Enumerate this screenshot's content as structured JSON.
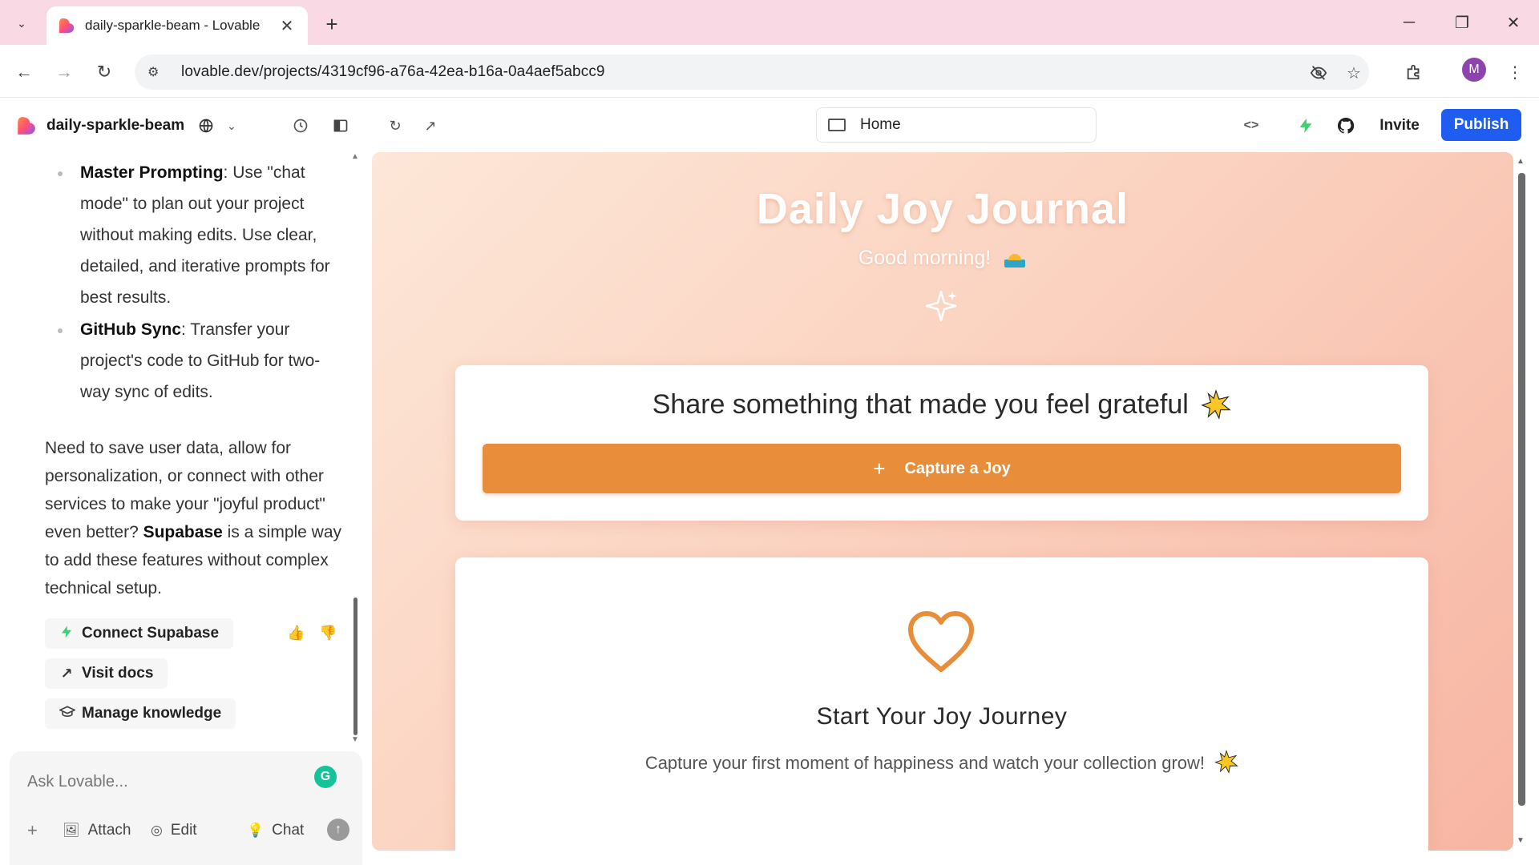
{
  "browser": {
    "tab_title": "daily-sparkle-beam - Lovable",
    "url": "lovable.dev/projects/4319cf96-a76a-42ea-b16a-0a4aef5abcc9",
    "profile_initial": "M"
  },
  "app_header": {
    "project_name": "daily-sparkle-beam",
    "route": "Home",
    "invite_label": "Invite",
    "publish_label": "Publish"
  },
  "chat": {
    "bullets": [
      {
        "title": "Master Prompting",
        "text": ": Use \"chat mode\" to plan out your project without making edits. Use clear, detailed, and iterative prompts for best results."
      },
      {
        "title": "GitHub Sync",
        "text": ": Transfer your project's code to GitHub for two-way sync of edits."
      }
    ],
    "paragraph_before": "Need to save user data, allow for personalization, or connect with other services to make your \"joyful product\" even better? ",
    "paragraph_bold": "Supabase",
    "paragraph_after": " is a simple way to add these features without complex technical setup.",
    "actions": {
      "connect_supabase": "Connect Supabase",
      "visit_docs": "Visit docs",
      "manage_knowledge": "Manage knowledge"
    },
    "composer": {
      "placeholder": "Ask Lovable...",
      "attach": "Attach",
      "edit": "Edit",
      "chat": "Chat"
    }
  },
  "preview": {
    "title": "Daily Joy Journal",
    "greeting": "Good morning!",
    "card1_title": "Share something that made you feel grateful",
    "capture_button": "Capture a Joy",
    "card2_title": "Start Your Joy Journey",
    "card2_subtitle": "Capture your first moment of happiness and watch your collection grow!"
  },
  "colors": {
    "publish": "#1f5cf0",
    "capture_button": "#e88e3a",
    "heart": "#e88e3a",
    "tabstrip": "#f9d9e4",
    "bolt": "#3ecf6e"
  }
}
